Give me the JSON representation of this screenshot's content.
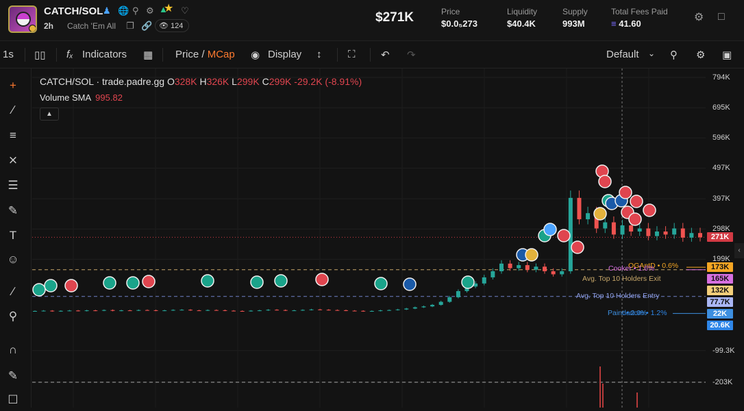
{
  "header": {
    "ticker": "CATCH/SOL",
    "age": "2h",
    "name": "Catch 'Em All",
    "watchers": "124",
    "market_cap": "$271K",
    "stats": [
      {
        "label": "Price",
        "value": "$0.0₅273"
      },
      {
        "label": "Liquidity",
        "value": "$40.4K"
      },
      {
        "label": "Supply",
        "value": "993M"
      },
      {
        "label": "Total Fees Paid",
        "value": "41.60"
      }
    ]
  },
  "toolbar": {
    "interval": "1s",
    "indicators": "Indicators",
    "price_label": "Price",
    "mcap_label": "MCap",
    "display": "Display",
    "layout": "Default"
  },
  "legend": {
    "title": "CATCH/SOL · trade.padre.gg",
    "o_label": "O",
    "o_val": "328K",
    "h_label": "H",
    "h_val": "326K",
    "l_label": "L",
    "l_val": "299K",
    "c_label": "C",
    "c_val": "299K",
    "change": "-29.2K (-8.91%)",
    "volume_label": "Volume SMA",
    "volume_val": "995.82"
  },
  "axis": {
    "ticks": [
      "794K",
      "695K",
      "596K",
      "497K",
      "397K",
      "298K",
      "199K",
      "-99.3K",
      "-203K"
    ],
    "tags": [
      {
        "text": "271K",
        "bg": "#d23a44",
        "fg": "#ffffff"
      },
      {
        "text": "173K",
        "bg": "#f5a623",
        "fg": "#111111"
      },
      {
        "text": "165K",
        "bg": "#d66fe0",
        "fg": "#111111"
      },
      {
        "text": "132K",
        "bg": "#f3cf7a",
        "fg": "#111111"
      },
      {
        "text": "77.7K",
        "bg": "#a9b6f4",
        "fg": "#111111"
      },
      {
        "text": "22K",
        "bg": "#3d8fe0",
        "fg": "#ffffff"
      },
      {
        "text": "20.6K",
        "bg": "#2e86e8",
        "fg": "#ffffff"
      }
    ]
  },
  "lines": {
    "oganid": "OGAntD • 0.6%",
    "cooker": "Cooker • 1.6%",
    "top10_exit": "Avg. Top 10 Holders Exit",
    "top10_entry": "Avg. Top 10 Holders Entry",
    "paint": "Paint • 2.0%",
    "danom": "danom • 1.2%"
  },
  "colors": {
    "up": "#26a69a",
    "down": "#ef5350",
    "accent": "#ff7a2f"
  },
  "chart_data": {
    "type": "candlestick",
    "unit": "market cap (USD)",
    "ylim": [
      -203000,
      794000
    ],
    "open": 328000,
    "high": 326000,
    "low": 299000,
    "close": 299000,
    "last": 271000,
    "series": [
      {
        "name": "Market Cap",
        "values": [
          30000,
          31000,
          29000,
          30500,
          31500,
          30000,
          32000,
          31000,
          33000,
          30500,
          32000,
          31500,
          33000,
          32500,
          31000,
          32000,
          33500,
          34000,
          32000,
          31500,
          33000,
          32500,
          31000,
          30000,
          29500,
          31000,
          32000,
          34000,
          33000,
          31500,
          32000,
          33500,
          35000,
          34000,
          33000,
          32500,
          31000,
          30500,
          29000,
          30000,
          32000,
          33000,
          35000,
          38000,
          42000,
          45000,
          50000,
          60000,
          75000,
          95000,
          110000,
          120000,
          140000,
          160000,
          185000,
          170000,
          180000,
          165000,
          175000,
          160000,
          150000,
          160000,
          400000,
          330000,
          350000,
          300000,
          320000,
          280000,
          310000,
          290000,
          300000,
          275000,
          290000,
          280000,
          300000,
          270000,
          285000,
          271000
        ]
      }
    ]
  }
}
